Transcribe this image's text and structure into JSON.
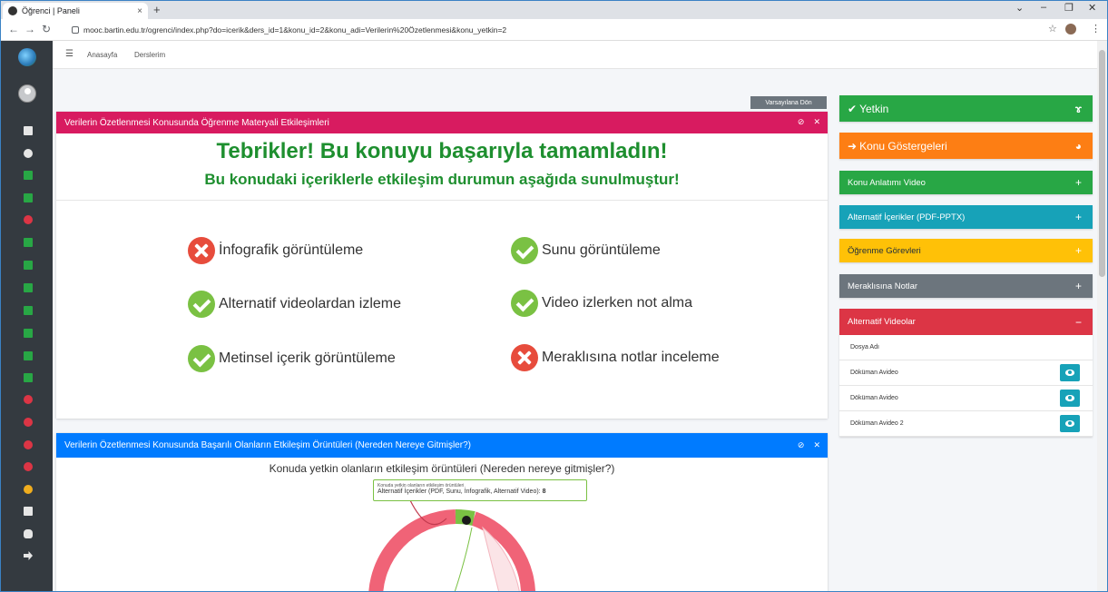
{
  "browser": {
    "tab_title": "Öğrenci | Paneli",
    "tab_close": "×",
    "new_tab": "+",
    "url": "mooc.bartin.edu.tr/ogrenci/index.php?do=icerik&ders_id=1&konu_id=2&konu_adi=Verilerin%20Özetlenmesi&konu_yetkin=2"
  },
  "topnav": {
    "home": "Anasayfa",
    "courses": "Derslerim"
  },
  "reset_button": "Varsayılana Dön",
  "card1": {
    "title": "Verilerin Özetlenmesi Konusunda Öğrenme Materyali Etkileşimleri",
    "congrats": "Tebrikler! Bu konuyu başarıyla tamamladın!",
    "subtitle": "Bu konudaki içeriklerle etkileşim durumun aşağıda sunulmuştur!",
    "items": [
      {
        "label": "İnfografik görüntüleme",
        "status": "no"
      },
      {
        "label": "Sunu görüntüleme",
        "status": "ok"
      },
      {
        "label": "Alternatif videolardan izleme",
        "status": "ok"
      },
      {
        "label": "Video izlerken not alma",
        "status": "ok"
      },
      {
        "label": "Metinsel içerik görüntüleme",
        "status": "ok"
      },
      {
        "label": "Meraklısına notlar inceleme",
        "status": "no"
      }
    ]
  },
  "card2": {
    "title": "Verilerin Özetlenmesi Konusunda Başarılı Olanların Etkileşim Örüntüleri (Nereden Nereye Gitmişler?)",
    "chart_title": "Konuda yetkin olanların etkileşim örüntüleri (Nereden nereye gitmişler?)",
    "tooltip_small": "Konuda yetkin olanların etkileşim örüntüleri",
    "tooltip_label": "Alternatif İçerikler (PDF, Sunu, İnfografik, Alternatif Video):",
    "tooltip_value": "8"
  },
  "panels": {
    "yetkin": "Yetkin",
    "gostergeler": "Konu Göstergeleri",
    "video": "Konu Anlatımı Video",
    "alternatif": "Alternatif İçerikler (PDF-PPTX)",
    "gorevler": "Öğrenme Görevleri",
    "meraklisina": "Meraklısına Notlar",
    "alt_videolar": "Alternatif Videolar",
    "plus": "+",
    "minus": "−"
  },
  "video_list": {
    "header": "Dosya Adı",
    "rows": [
      "Döküman Avideo",
      "Döküman Avideo",
      "Döküman Avideo 2"
    ]
  },
  "colors": {
    "accent_pink": "#d81b60",
    "accent_blue": "#007bff",
    "success_green": "#28a745",
    "sidebar_dark": "#343a40"
  }
}
